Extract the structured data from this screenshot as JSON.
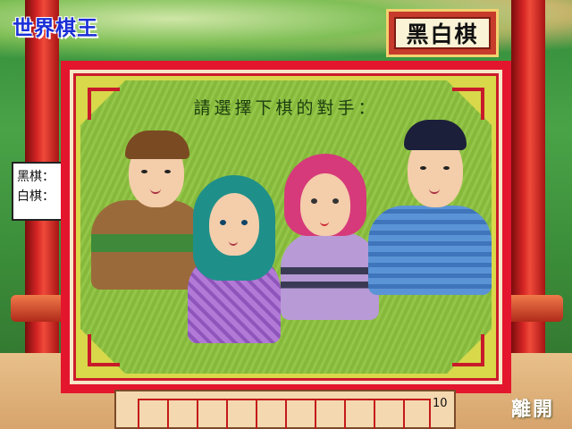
{
  "app": {
    "logo_text": "世界棋王"
  },
  "game": {
    "title": "黑白棋"
  },
  "players": {
    "black_label": "黑棋：",
    "white_label": "白棋："
  },
  "dialog": {
    "prompt": "請選擇下棋的對手：",
    "opponents": [
      {
        "id": "opponent-man-brown-hair",
        "colors": {
          "shirt": "#9b6a3a",
          "stripe": "#3e8a3a",
          "hair": "#7a4a22"
        }
      },
      {
        "id": "opponent-girl-teal-hair",
        "colors": {
          "shirt": "#b27ad6",
          "hair": "#1f8f8a"
        }
      },
      {
        "id": "opponent-girl-pink-hair",
        "colors": {
          "shirt": "#b79ad6",
          "stripe": "#3a3a55",
          "hair": "#d63a7a"
        }
      },
      {
        "id": "opponent-man-black-hair",
        "colors": {
          "shirt": "#5b94d6",
          "hair": "#1b1f3a"
        }
      }
    ]
  },
  "footer": {
    "score_value": "10",
    "exit_label": "離開"
  }
}
